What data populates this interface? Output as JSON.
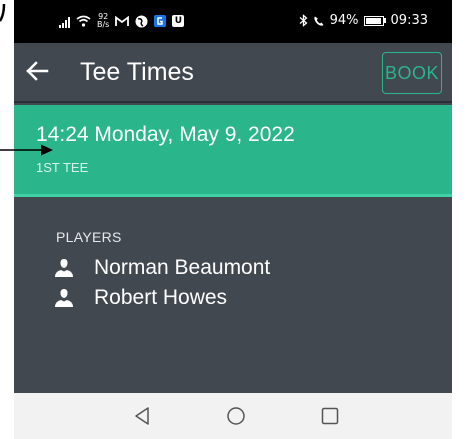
{
  "status_bar": {
    "network_speed_value": "92",
    "network_speed_unit": "B/s",
    "notification_icons": [
      "gmail-icon",
      "globe-icon",
      "app-icon-blue",
      "app-icon-u"
    ],
    "app_icon_u_glyph": "U",
    "battery": "94%",
    "battery_level": 0.94,
    "time": "09:33"
  },
  "app_bar": {
    "title": "Tee Times",
    "book_label": "BOOK"
  },
  "tee_time": {
    "datetime": "14:24 Monday, May 9, 2022",
    "course": "1ST TEE"
  },
  "players": {
    "heading": "PLAYERS",
    "list": [
      "Norman Beaumont",
      "Robert Howes"
    ]
  },
  "colors": {
    "accent": "#2ab58a",
    "app_background": "#424850",
    "status_bar": "#000000"
  }
}
